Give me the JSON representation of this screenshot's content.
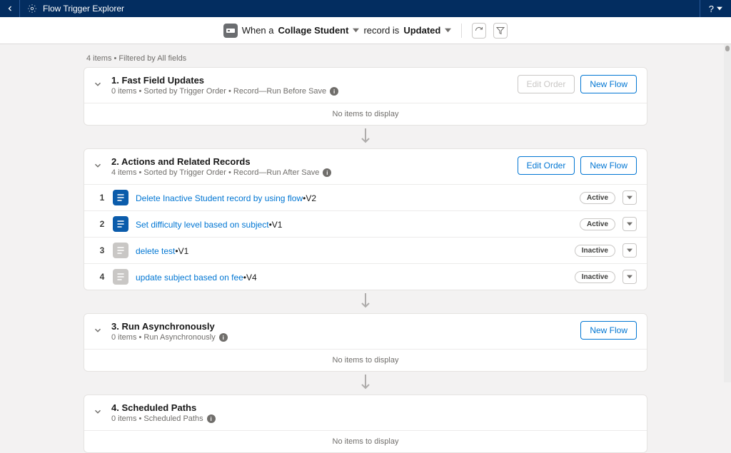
{
  "topbar": {
    "app_title": "Flow Trigger Explorer",
    "help_label": "?"
  },
  "context": {
    "prefix": "When a",
    "object": "Collage Student",
    "middle": "record is",
    "action": "Updated"
  },
  "meta_line": "4 items  •  Filtered by All fields",
  "sections": [
    {
      "title": "1. Fast Field Updates",
      "sub": "0 items • Sorted by Trigger Order • Record—Run Before Save",
      "edit_order_enabled": false,
      "new_flow": true,
      "empty": "No items to display",
      "flows": []
    },
    {
      "title": "2. Actions and Related Records",
      "sub": "4 items • Sorted by Trigger Order • Record—Run After Save",
      "edit_order_enabled": true,
      "new_flow": true,
      "empty": "",
      "flows": [
        {
          "num": "1",
          "name": "Delete Inactive Student record by using flow",
          "ver": "•V2",
          "status": "Active",
          "active": true
        },
        {
          "num": "2",
          "name": "Set difficulty level based on subject",
          "ver": "•V1",
          "status": "Active",
          "active": true
        },
        {
          "num": "3",
          "name": "delete test",
          "ver": "•V1",
          "status": "Inactive",
          "active": false
        },
        {
          "num": "4",
          "name": "update subject based on fee",
          "ver": "•V4",
          "status": "Inactive",
          "active": false
        }
      ]
    },
    {
      "title": "3. Run Asynchronously",
      "sub": "0 items • Run Asynchronously",
      "edit_order_enabled": null,
      "new_flow": true,
      "empty": "No items to display",
      "flows": []
    },
    {
      "title": "4. Scheduled Paths",
      "sub": "0 items • Scheduled Paths",
      "edit_order_enabled": null,
      "new_flow": false,
      "empty": "No items to display",
      "flows": []
    }
  ],
  "labels": {
    "edit_order": "Edit Order",
    "new_flow": "New Flow"
  }
}
